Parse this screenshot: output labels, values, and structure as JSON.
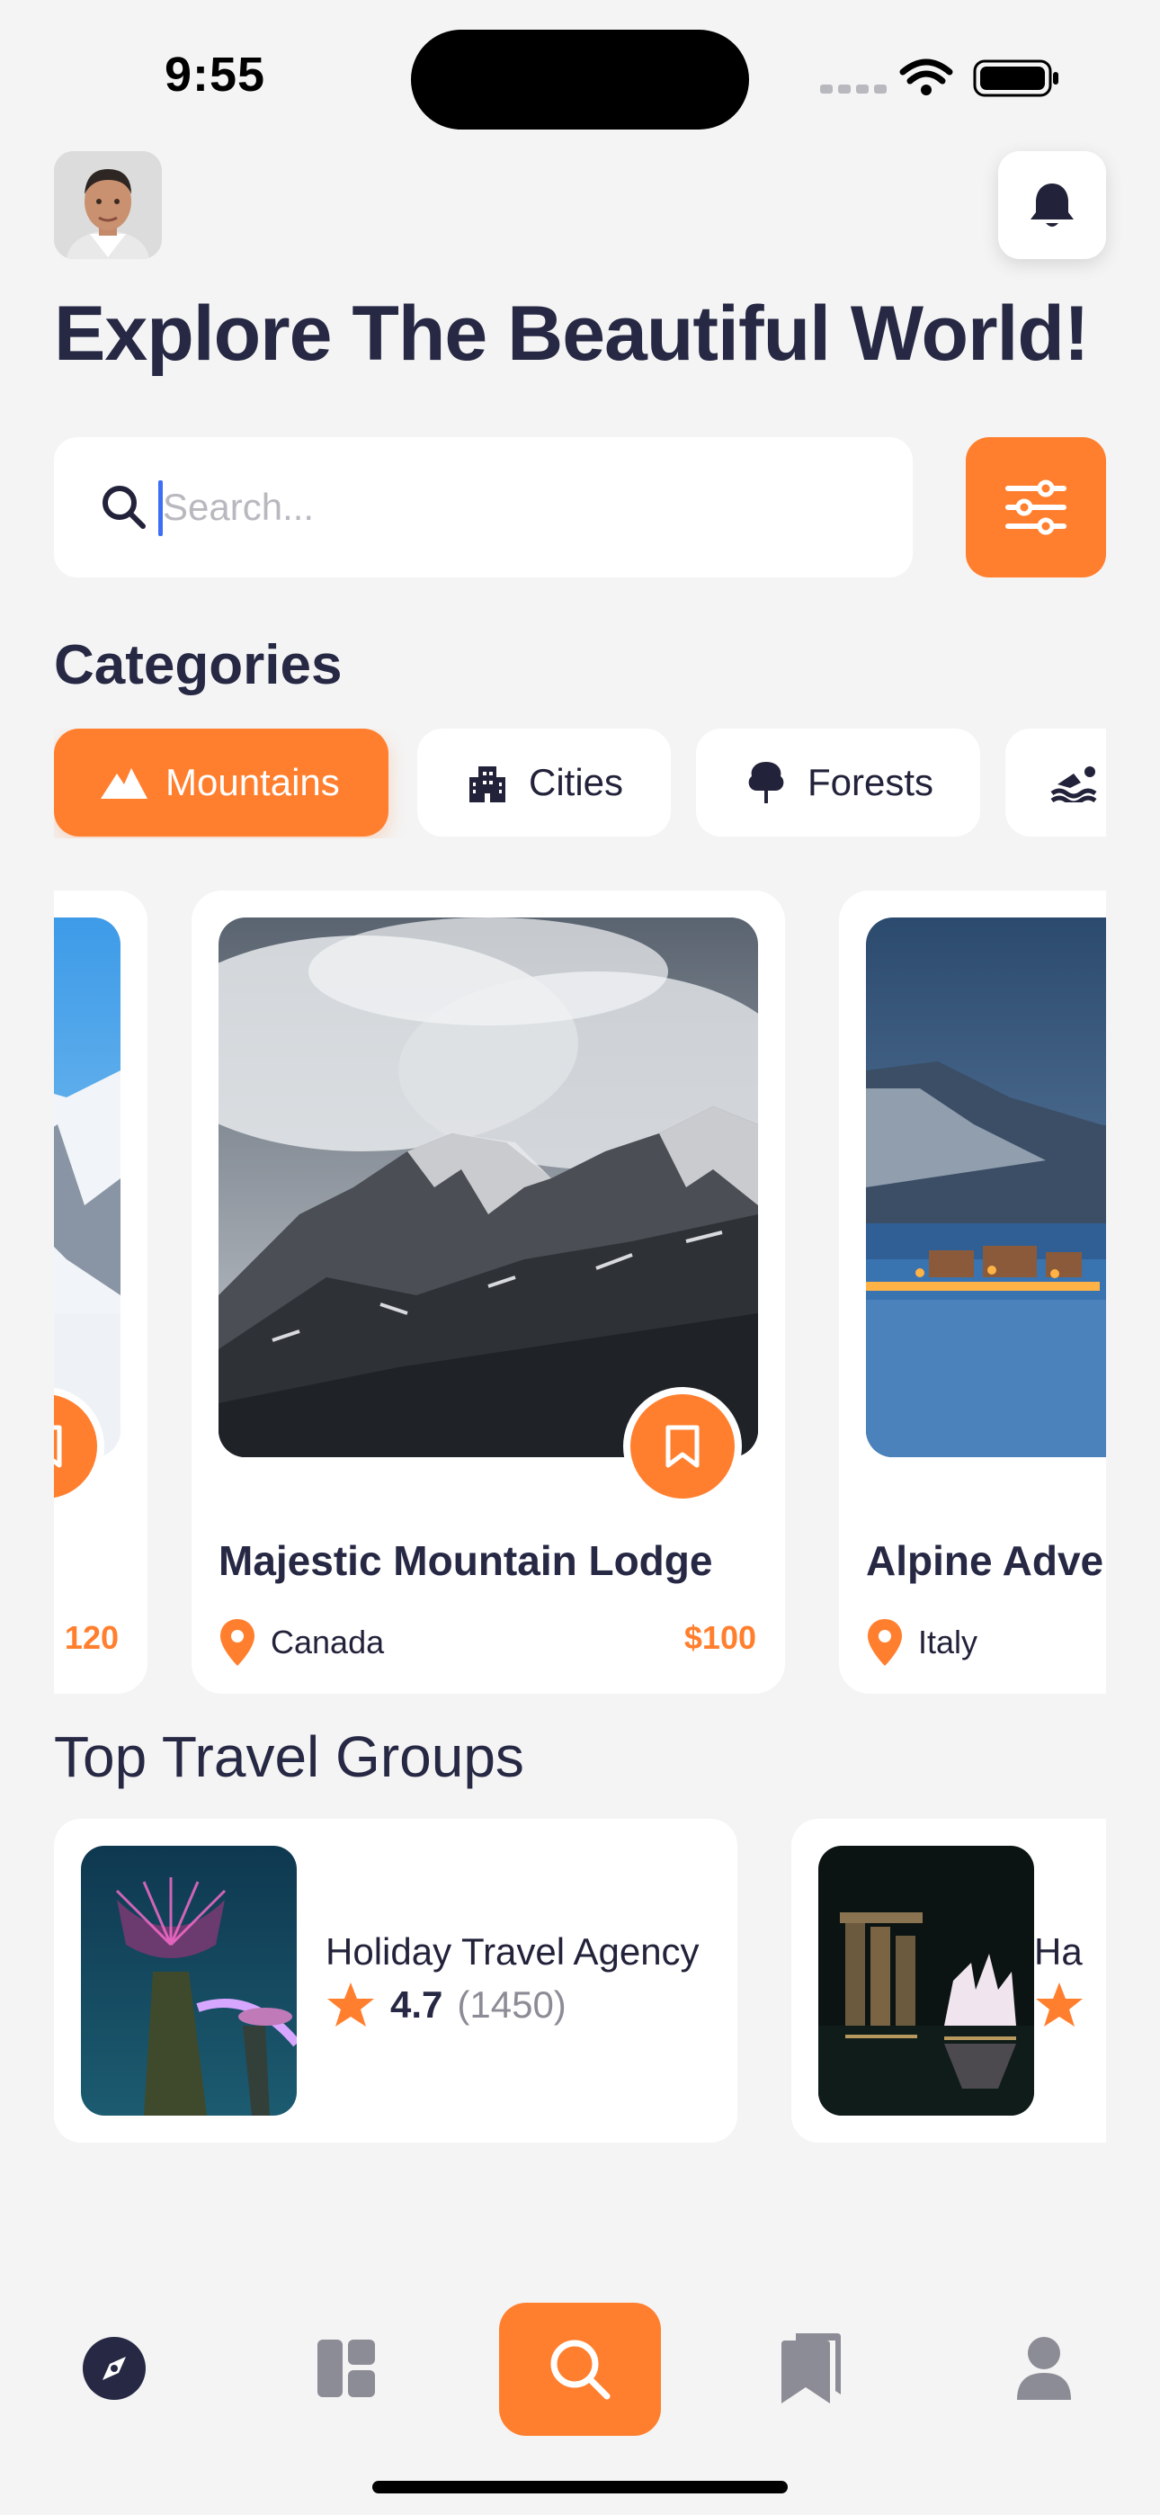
{
  "status_bar": {
    "time": "9:55"
  },
  "header": {
    "title": "Explore The Beautiful World!"
  },
  "search": {
    "placeholder": "Search..."
  },
  "categories": {
    "title": "Categories",
    "items": [
      {
        "label": "Mountains",
        "icon": "mountain-icon",
        "active": true
      },
      {
        "label": "Cities",
        "icon": "city-icon",
        "active": false
      },
      {
        "label": "Forests",
        "icon": "tree-icon",
        "active": false
      },
      {
        "label": "",
        "icon": "swimmer-icon",
        "active": false
      }
    ]
  },
  "places": [
    {
      "name": "",
      "location": "",
      "price": "120"
    },
    {
      "name": "Majestic Mountain Lodge",
      "location": "Canada",
      "price": "$100"
    },
    {
      "name": "Alpine Adve",
      "location": "Italy",
      "price": ""
    }
  ],
  "travel_groups": {
    "title": "Top Travel Groups",
    "items": [
      {
        "name": "Holiday Travel Agency",
        "rating": "4.7",
        "count": "(1450)"
      },
      {
        "name": "Ha",
        "rating": "",
        "count": ""
      }
    ]
  },
  "bottom_nav": {
    "items": [
      {
        "icon": "compass-icon"
      },
      {
        "icon": "dashboard-icon"
      },
      {
        "icon": "search-icon",
        "active": true
      },
      {
        "icon": "bookmarks-icon"
      },
      {
        "icon": "user-icon"
      }
    ]
  },
  "colors": {
    "accent": "#FF7F2E",
    "background": "#F4F4F4",
    "title": "#262844"
  }
}
